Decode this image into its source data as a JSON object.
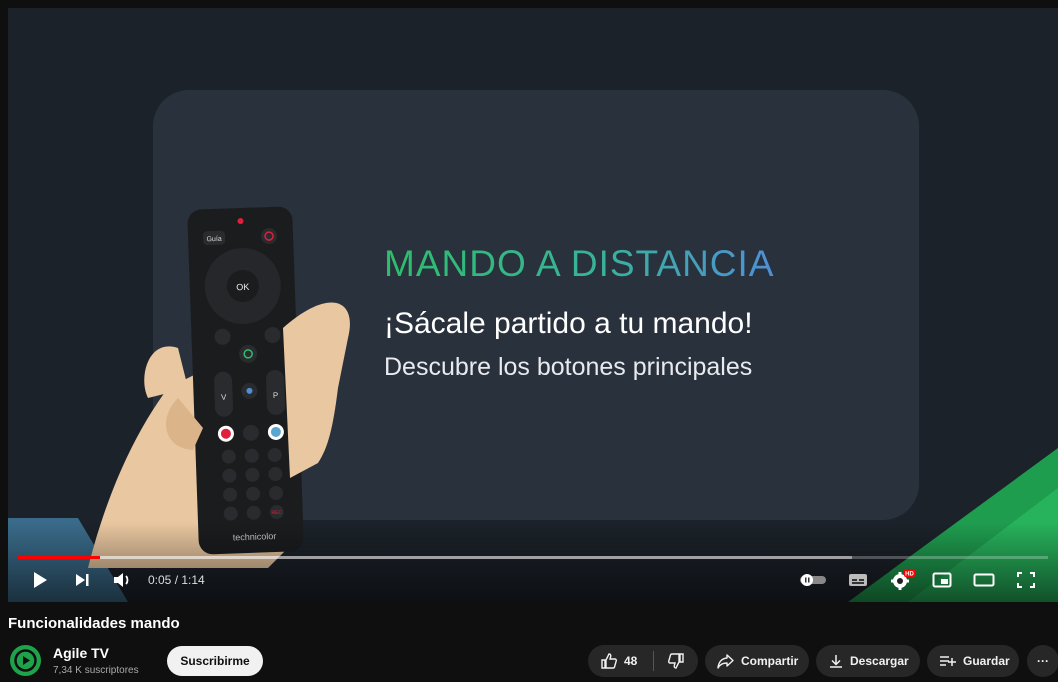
{
  "video": {
    "heading": "MANDO A DISTANCIA",
    "subtitle": "¡Sácale partido a tu mando!",
    "subtitle2": "Descubre los botones principales",
    "remote_brand": "technicolor",
    "remote_guide": "Guía",
    "remote_ok": "OK",
    "remote_v": "V",
    "remote_p": "P",
    "remote_rec": "REC"
  },
  "player": {
    "current_time": "0:05",
    "separator": " / ",
    "duration": "1:14",
    "progress_played_fraction": 0.08,
    "progress_loaded_fraction": 0.81,
    "hd_badge": "HD",
    "icons": [
      "play-icon",
      "next-icon",
      "volume-icon",
      "autoplay-toggle-icon",
      "subtitles-icon",
      "settings-icon",
      "miniplayer-icon",
      "theater-icon",
      "fullscreen-icon"
    ]
  },
  "meta": {
    "title": "Funcionalidades mando",
    "channel_name": "Agile TV",
    "subscribers": "7,34 K suscriptores",
    "subscribe_label": "Suscribirme",
    "likes": "48",
    "share_label": "Compartir",
    "download_label": "Descargar",
    "save_label": "Guardar",
    "more_label": "···"
  },
  "colors": {
    "accent_red": "#ff0000",
    "heading_green": "#2ebd6b",
    "heading_blue": "#4f8fd8",
    "channel_green": "#1fa34a"
  }
}
